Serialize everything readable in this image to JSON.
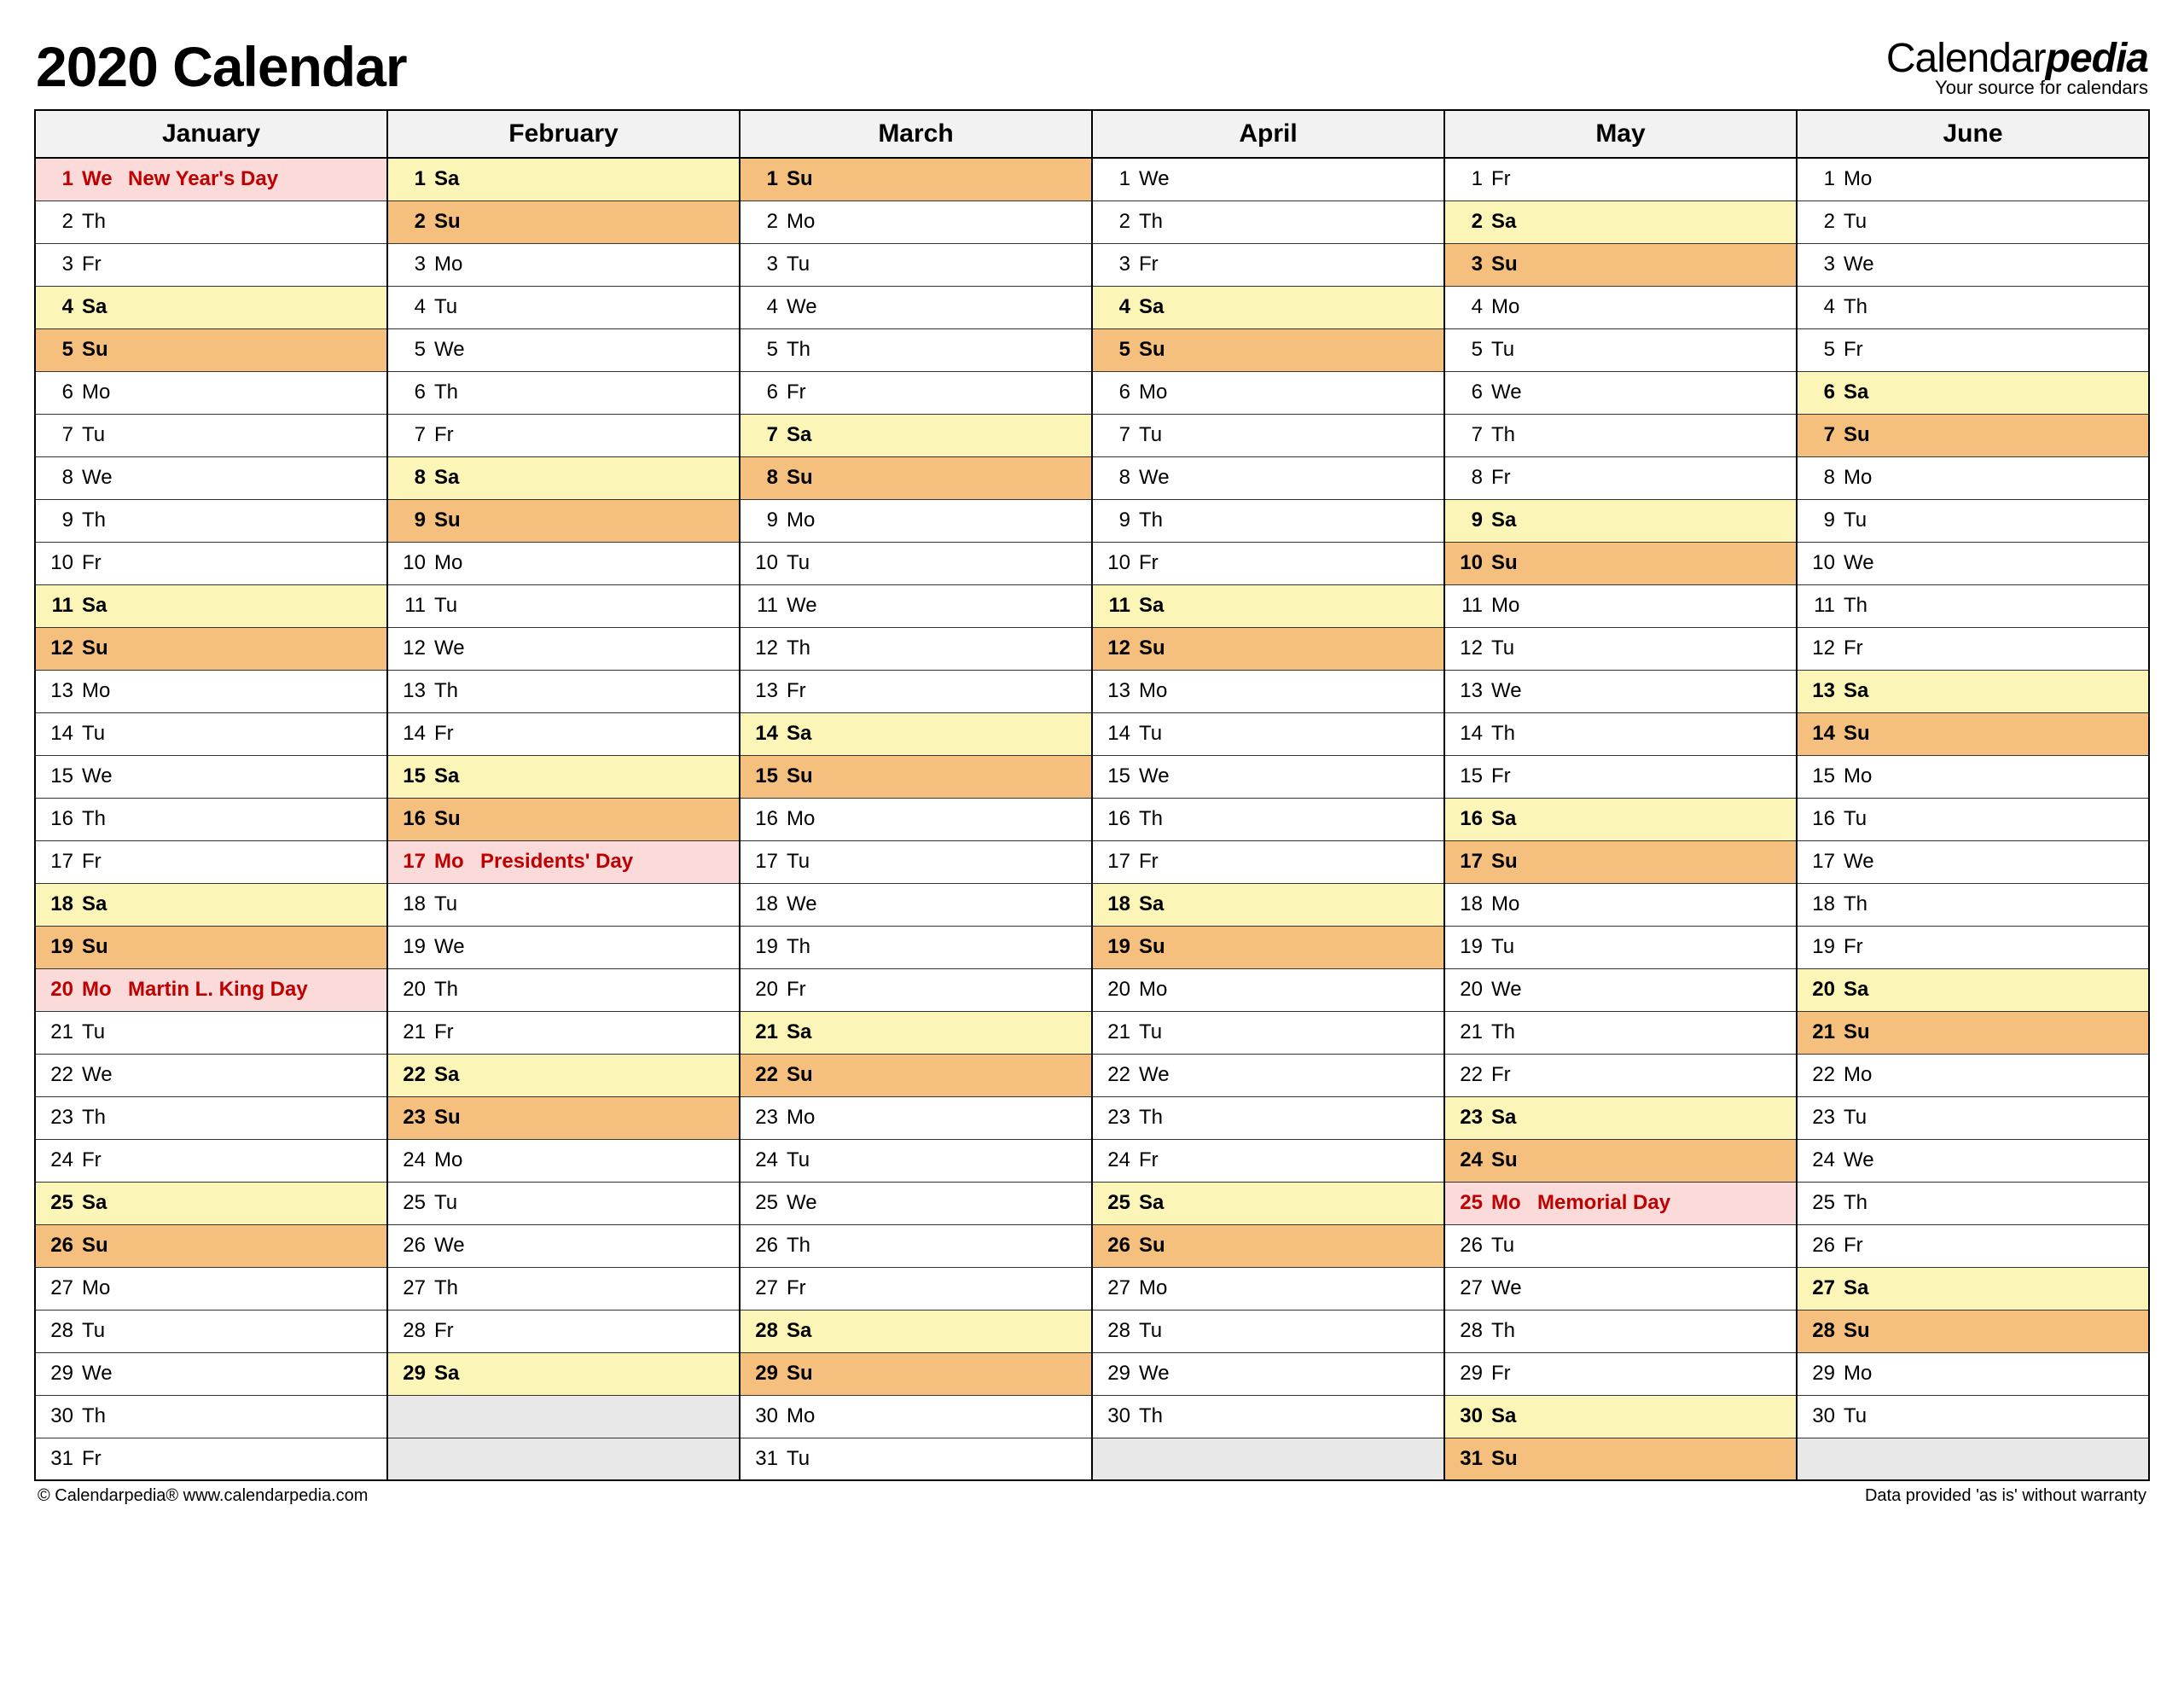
{
  "title": "2020 Calendar",
  "brand": {
    "prefix": "Calendar",
    "suffix": "pedia",
    "tagline": "Your source for calendars"
  },
  "footer": {
    "left": "© Calendarpedia®   www.calendarpedia.com",
    "right": "Data provided 'as is' without warranty"
  },
  "months": [
    "January",
    "February",
    "March",
    "April",
    "May",
    "June"
  ],
  "chart_data": {
    "type": "table",
    "title": "2020 Calendar – January to June",
    "columns": [
      "January",
      "February",
      "March",
      "April",
      "May",
      "June"
    ],
    "rows": [
      [
        {
          "d": 1,
          "w": "We",
          "t": "hol",
          "e": "New Year's Day"
        },
        {
          "d": 1,
          "w": "Sa",
          "t": "sat"
        },
        {
          "d": 1,
          "w": "Su",
          "t": "sun"
        },
        {
          "d": 1,
          "w": "We"
        },
        {
          "d": 1,
          "w": "Fr"
        },
        {
          "d": 1,
          "w": "Mo"
        }
      ],
      [
        {
          "d": 2,
          "w": "Th"
        },
        {
          "d": 2,
          "w": "Su",
          "t": "sun"
        },
        {
          "d": 2,
          "w": "Mo"
        },
        {
          "d": 2,
          "w": "Th"
        },
        {
          "d": 2,
          "w": "Sa",
          "t": "sat"
        },
        {
          "d": 2,
          "w": "Tu"
        }
      ],
      [
        {
          "d": 3,
          "w": "Fr"
        },
        {
          "d": 3,
          "w": "Mo"
        },
        {
          "d": 3,
          "w": "Tu"
        },
        {
          "d": 3,
          "w": "Fr"
        },
        {
          "d": 3,
          "w": "Su",
          "t": "sun"
        },
        {
          "d": 3,
          "w": "We"
        }
      ],
      [
        {
          "d": 4,
          "w": "Sa",
          "t": "sat"
        },
        {
          "d": 4,
          "w": "Tu"
        },
        {
          "d": 4,
          "w": "We"
        },
        {
          "d": 4,
          "w": "Sa",
          "t": "sat"
        },
        {
          "d": 4,
          "w": "Mo"
        },
        {
          "d": 4,
          "w": "Th"
        }
      ],
      [
        {
          "d": 5,
          "w": "Su",
          "t": "sun"
        },
        {
          "d": 5,
          "w": "We"
        },
        {
          "d": 5,
          "w": "Th"
        },
        {
          "d": 5,
          "w": "Su",
          "t": "sun"
        },
        {
          "d": 5,
          "w": "Tu"
        },
        {
          "d": 5,
          "w": "Fr"
        }
      ],
      [
        {
          "d": 6,
          "w": "Mo"
        },
        {
          "d": 6,
          "w": "Th"
        },
        {
          "d": 6,
          "w": "Fr"
        },
        {
          "d": 6,
          "w": "Mo"
        },
        {
          "d": 6,
          "w": "We"
        },
        {
          "d": 6,
          "w": "Sa",
          "t": "sat"
        }
      ],
      [
        {
          "d": 7,
          "w": "Tu"
        },
        {
          "d": 7,
          "w": "Fr"
        },
        {
          "d": 7,
          "w": "Sa",
          "t": "sat"
        },
        {
          "d": 7,
          "w": "Tu"
        },
        {
          "d": 7,
          "w": "Th"
        },
        {
          "d": 7,
          "w": "Su",
          "t": "sun"
        }
      ],
      [
        {
          "d": 8,
          "w": "We"
        },
        {
          "d": 8,
          "w": "Sa",
          "t": "sat"
        },
        {
          "d": 8,
          "w": "Su",
          "t": "sun"
        },
        {
          "d": 8,
          "w": "We"
        },
        {
          "d": 8,
          "w": "Fr"
        },
        {
          "d": 8,
          "w": "Mo"
        }
      ],
      [
        {
          "d": 9,
          "w": "Th"
        },
        {
          "d": 9,
          "w": "Su",
          "t": "sun"
        },
        {
          "d": 9,
          "w": "Mo"
        },
        {
          "d": 9,
          "w": "Th"
        },
        {
          "d": 9,
          "w": "Sa",
          "t": "sat"
        },
        {
          "d": 9,
          "w": "Tu"
        }
      ],
      [
        {
          "d": 10,
          "w": "Fr"
        },
        {
          "d": 10,
          "w": "Mo"
        },
        {
          "d": 10,
          "w": "Tu"
        },
        {
          "d": 10,
          "w": "Fr"
        },
        {
          "d": 10,
          "w": "Su",
          "t": "sun"
        },
        {
          "d": 10,
          "w": "We"
        }
      ],
      [
        {
          "d": 11,
          "w": "Sa",
          "t": "sat"
        },
        {
          "d": 11,
          "w": "Tu"
        },
        {
          "d": 11,
          "w": "We"
        },
        {
          "d": 11,
          "w": "Sa",
          "t": "sat"
        },
        {
          "d": 11,
          "w": "Mo"
        },
        {
          "d": 11,
          "w": "Th"
        }
      ],
      [
        {
          "d": 12,
          "w": "Su",
          "t": "sun"
        },
        {
          "d": 12,
          "w": "We"
        },
        {
          "d": 12,
          "w": "Th"
        },
        {
          "d": 12,
          "w": "Su",
          "t": "sun"
        },
        {
          "d": 12,
          "w": "Tu"
        },
        {
          "d": 12,
          "w": "Fr"
        }
      ],
      [
        {
          "d": 13,
          "w": "Mo"
        },
        {
          "d": 13,
          "w": "Th"
        },
        {
          "d": 13,
          "w": "Fr"
        },
        {
          "d": 13,
          "w": "Mo"
        },
        {
          "d": 13,
          "w": "We"
        },
        {
          "d": 13,
          "w": "Sa",
          "t": "sat"
        }
      ],
      [
        {
          "d": 14,
          "w": "Tu"
        },
        {
          "d": 14,
          "w": "Fr"
        },
        {
          "d": 14,
          "w": "Sa",
          "t": "sat"
        },
        {
          "d": 14,
          "w": "Tu"
        },
        {
          "d": 14,
          "w": "Th"
        },
        {
          "d": 14,
          "w": "Su",
          "t": "sun"
        }
      ],
      [
        {
          "d": 15,
          "w": "We"
        },
        {
          "d": 15,
          "w": "Sa",
          "t": "sat"
        },
        {
          "d": 15,
          "w": "Su",
          "t": "sun"
        },
        {
          "d": 15,
          "w": "We"
        },
        {
          "d": 15,
          "w": "Fr"
        },
        {
          "d": 15,
          "w": "Mo"
        }
      ],
      [
        {
          "d": 16,
          "w": "Th"
        },
        {
          "d": 16,
          "w": "Su",
          "t": "sun"
        },
        {
          "d": 16,
          "w": "Mo"
        },
        {
          "d": 16,
          "w": "Th"
        },
        {
          "d": 16,
          "w": "Sa",
          "t": "sat"
        },
        {
          "d": 16,
          "w": "Tu"
        }
      ],
      [
        {
          "d": 17,
          "w": "Fr"
        },
        {
          "d": 17,
          "w": "Mo",
          "t": "hol",
          "e": "Presidents' Day"
        },
        {
          "d": 17,
          "w": "Tu"
        },
        {
          "d": 17,
          "w": "Fr"
        },
        {
          "d": 17,
          "w": "Su",
          "t": "sun"
        },
        {
          "d": 17,
          "w": "We"
        }
      ],
      [
        {
          "d": 18,
          "w": "Sa",
          "t": "sat"
        },
        {
          "d": 18,
          "w": "Tu"
        },
        {
          "d": 18,
          "w": "We"
        },
        {
          "d": 18,
          "w": "Sa",
          "t": "sat"
        },
        {
          "d": 18,
          "w": "Mo"
        },
        {
          "d": 18,
          "w": "Th"
        }
      ],
      [
        {
          "d": 19,
          "w": "Su",
          "t": "sun"
        },
        {
          "d": 19,
          "w": "We"
        },
        {
          "d": 19,
          "w": "Th"
        },
        {
          "d": 19,
          "w": "Su",
          "t": "sun"
        },
        {
          "d": 19,
          "w": "Tu"
        },
        {
          "d": 19,
          "w": "Fr"
        }
      ],
      [
        {
          "d": 20,
          "w": "Mo",
          "t": "hol",
          "e": "Martin L. King Day"
        },
        {
          "d": 20,
          "w": "Th"
        },
        {
          "d": 20,
          "w": "Fr"
        },
        {
          "d": 20,
          "w": "Mo"
        },
        {
          "d": 20,
          "w": "We"
        },
        {
          "d": 20,
          "w": "Sa",
          "t": "sat"
        }
      ],
      [
        {
          "d": 21,
          "w": "Tu"
        },
        {
          "d": 21,
          "w": "Fr"
        },
        {
          "d": 21,
          "w": "Sa",
          "t": "sat"
        },
        {
          "d": 21,
          "w": "Tu"
        },
        {
          "d": 21,
          "w": "Th"
        },
        {
          "d": 21,
          "w": "Su",
          "t": "sun"
        }
      ],
      [
        {
          "d": 22,
          "w": "We"
        },
        {
          "d": 22,
          "w": "Sa",
          "t": "sat"
        },
        {
          "d": 22,
          "w": "Su",
          "t": "sun"
        },
        {
          "d": 22,
          "w": "We"
        },
        {
          "d": 22,
          "w": "Fr"
        },
        {
          "d": 22,
          "w": "Mo"
        }
      ],
      [
        {
          "d": 23,
          "w": "Th"
        },
        {
          "d": 23,
          "w": "Su",
          "t": "sun"
        },
        {
          "d": 23,
          "w": "Mo"
        },
        {
          "d": 23,
          "w": "Th"
        },
        {
          "d": 23,
          "w": "Sa",
          "t": "sat"
        },
        {
          "d": 23,
          "w": "Tu"
        }
      ],
      [
        {
          "d": 24,
          "w": "Fr"
        },
        {
          "d": 24,
          "w": "Mo"
        },
        {
          "d": 24,
          "w": "Tu"
        },
        {
          "d": 24,
          "w": "Fr"
        },
        {
          "d": 24,
          "w": "Su",
          "t": "sun"
        },
        {
          "d": 24,
          "w": "We"
        }
      ],
      [
        {
          "d": 25,
          "w": "Sa",
          "t": "sat"
        },
        {
          "d": 25,
          "w": "Tu"
        },
        {
          "d": 25,
          "w": "We"
        },
        {
          "d": 25,
          "w": "Sa",
          "t": "sat"
        },
        {
          "d": 25,
          "w": "Mo",
          "t": "hol",
          "e": "Memorial Day"
        },
        {
          "d": 25,
          "w": "Th"
        }
      ],
      [
        {
          "d": 26,
          "w": "Su",
          "t": "sun"
        },
        {
          "d": 26,
          "w": "We"
        },
        {
          "d": 26,
          "w": "Th"
        },
        {
          "d": 26,
          "w": "Su",
          "t": "sun"
        },
        {
          "d": 26,
          "w": "Tu"
        },
        {
          "d": 26,
          "w": "Fr"
        }
      ],
      [
        {
          "d": 27,
          "w": "Mo"
        },
        {
          "d": 27,
          "w": "Th"
        },
        {
          "d": 27,
          "w": "Fr"
        },
        {
          "d": 27,
          "w": "Mo"
        },
        {
          "d": 27,
          "w": "We"
        },
        {
          "d": 27,
          "w": "Sa",
          "t": "sat"
        }
      ],
      [
        {
          "d": 28,
          "w": "Tu"
        },
        {
          "d": 28,
          "w": "Fr"
        },
        {
          "d": 28,
          "w": "Sa",
          "t": "sat"
        },
        {
          "d": 28,
          "w": "Tu"
        },
        {
          "d": 28,
          "w": "Th"
        },
        {
          "d": 28,
          "w": "Su",
          "t": "sun"
        }
      ],
      [
        {
          "d": 29,
          "w": "We"
        },
        {
          "d": 29,
          "w": "Sa",
          "t": "sat"
        },
        {
          "d": 29,
          "w": "Su",
          "t": "sun"
        },
        {
          "d": 29,
          "w": "We"
        },
        {
          "d": 29,
          "w": "Fr"
        },
        {
          "d": 29,
          "w": "Mo"
        }
      ],
      [
        {
          "d": 30,
          "w": "Th"
        },
        null,
        {
          "d": 30,
          "w": "Mo"
        },
        {
          "d": 30,
          "w": "Th"
        },
        {
          "d": 30,
          "w": "Sa",
          "t": "sat"
        },
        {
          "d": 30,
          "w": "Tu"
        }
      ],
      [
        {
          "d": 31,
          "w": "Fr"
        },
        null,
        {
          "d": 31,
          "w": "Tu"
        },
        null,
        {
          "d": 31,
          "w": "Su",
          "t": "sun"
        },
        null
      ]
    ]
  }
}
